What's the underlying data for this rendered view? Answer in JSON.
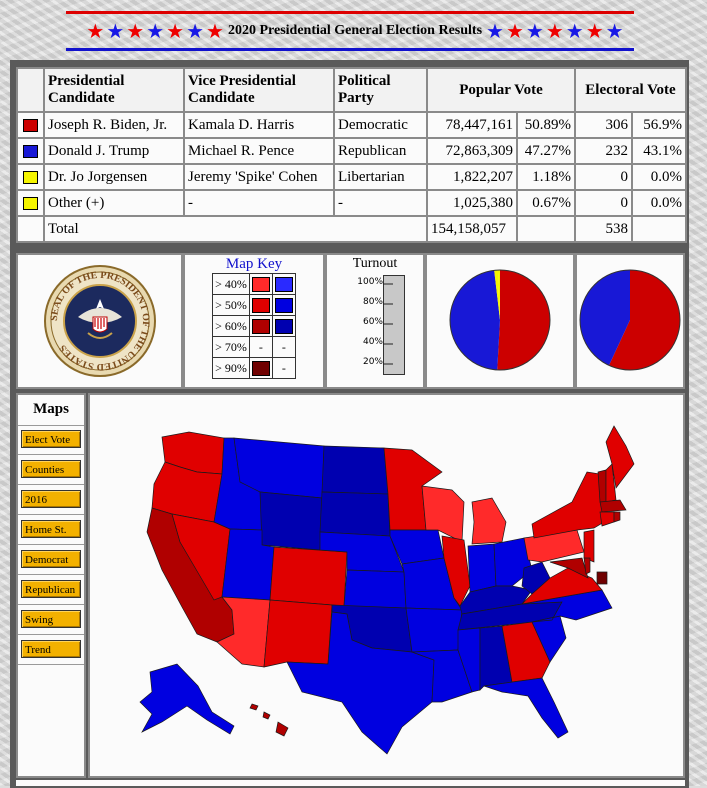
{
  "header": {
    "title": "2020 Presidential General Election Results"
  },
  "colors": {
    "dem": "#cc0000",
    "rep": "#1818d6",
    "lib": "#f5f500",
    "other": "#f5f500"
  },
  "table": {
    "headers": {
      "candidate": "Presidential Candidate",
      "vp": "Vice Presidential Candidate",
      "party": "Political Party",
      "popular": "Popular Vote",
      "electoral": "Electoral Vote"
    },
    "rows": [
      {
        "candidate": "Joseph R. Biden, Jr.",
        "vp": "Kamala D. Harris",
        "party": "Democratic",
        "votes": "78,447,161",
        "vote_pct": "50.89%",
        "ev": "306",
        "ev_pct": "56.9%",
        "color": "#cc0000"
      },
      {
        "candidate": "Donald J. Trump",
        "vp": "Michael R. Pence",
        "party": "Republican",
        "votes": "72,863,309",
        "vote_pct": "47.27%",
        "ev": "232",
        "ev_pct": "43.1%",
        "color": "#1818d6"
      },
      {
        "candidate": "Dr. Jo Jorgensen",
        "vp": "Jeremy 'Spike' Cohen",
        "party": "Libertarian",
        "votes": "1,822,207",
        "vote_pct": "1.18%",
        "ev": "0",
        "ev_pct": "0.0%",
        "color": "#f5f500"
      },
      {
        "candidate": "Other (+)",
        "vp": "-",
        "party": "-",
        "votes": "1,025,380",
        "vote_pct": "0.67%",
        "ev": "0",
        "ev_pct": "0.0%",
        "color": "#f5f500"
      }
    ],
    "total": {
      "label": "Total",
      "votes": "154,158,057",
      "ev": "538"
    }
  },
  "seal": {
    "text": "SEAL OF THE PRESIDENT OF THE UNITED STATES"
  },
  "map_key": {
    "title": "Map Key",
    "rows": [
      {
        "label": "> 40%",
        "dem": "#ff2a2a",
        "rep": "#2a2aff"
      },
      {
        "label": "> 50%",
        "dem": "#e00000",
        "rep": "#0000e0"
      },
      {
        "label": "> 60%",
        "dem": "#b00000",
        "rep": "#0000b0"
      },
      {
        "label": "> 70%",
        "dem": "-",
        "rep": "-"
      },
      {
        "label": "> 90%",
        "dem": "#700000",
        "rep": "-"
      }
    ]
  },
  "turnout": {
    "title": "Turnout",
    "ticks": [
      "100%",
      "80%",
      "60%",
      "40%",
      "20%"
    ]
  },
  "pie_popular": {
    "dem": 50.89,
    "rep": 47.27,
    "lib": 1.18,
    "other": 0.67
  },
  "pie_electoral": {
    "dem": 56.9,
    "rep": 43.1
  },
  "maps": {
    "title": "Maps",
    "buttons": [
      "Elect Vote",
      "Counties",
      "2016",
      "Home St.",
      "Democrat",
      "Republican",
      "Swing",
      "Trend"
    ]
  }
}
